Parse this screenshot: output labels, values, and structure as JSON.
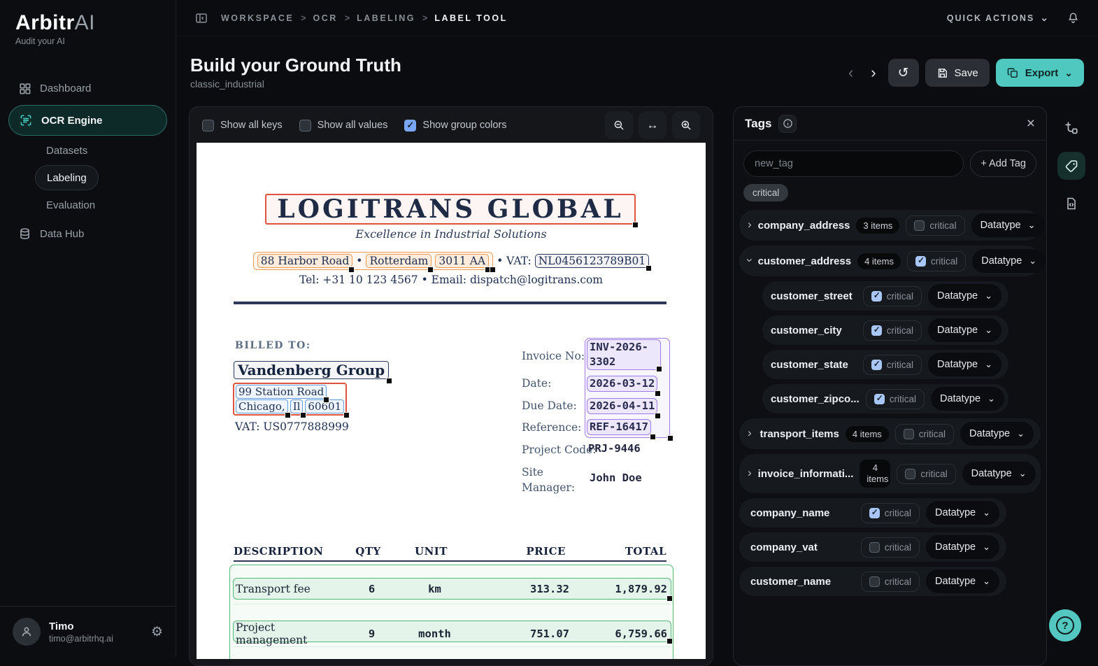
{
  "icons": {
    "chevron_left": "‹",
    "chevron_right": "›",
    "chevron_down": "⌄",
    "close": "×",
    "undo": "↺",
    "fit_width": "↔",
    "gear": "⚙",
    "question": "?"
  },
  "colors": {
    "accent": "#4fc8c0",
    "checkbox_blue": "#a9c6f8",
    "group_red": "#e0543f",
    "group_orange": "#f09a50",
    "group_blue": "#5f9ce0",
    "group_purple": "#9f7ce8",
    "group_green": "#53b979",
    "group_navy": "#2c3a5a"
  },
  "sidebar": {
    "brand": "Arbitr",
    "brand_suffix": "AI",
    "tagline": "Audit your AI",
    "dashboard": "Dashboard",
    "ocr_engine": "OCR Engine",
    "datasets": "Datasets",
    "labeling": "Labeling",
    "evaluation": "Evaluation",
    "data_hub": "Data Hub",
    "user": {
      "name": "Timo",
      "email": "timo@arbitrhq.ai"
    }
  },
  "topbar": {
    "breadcrumb": [
      "WORKSPACE",
      "OCR",
      "LABELING",
      "LABEL TOOL"
    ],
    "separator": ">",
    "quick_actions": "QUICK ACTIONS"
  },
  "header": {
    "title": "Build your Ground Truth",
    "subtitle": "classic_industrial",
    "save": "Save",
    "export": "Export"
  },
  "viewer": {
    "toggles": [
      {
        "label": "Show all keys",
        "checked": false
      },
      {
        "label": "Show all values",
        "checked": false
      },
      {
        "label": "Show group colors",
        "checked": true
      }
    ]
  },
  "document": {
    "company_name": "LOGITRANS GLOBAL",
    "tagline": "Excellence in Industrial Solutions",
    "address": {
      "street": "88 Harbor Road",
      "sep": "•",
      "city": "Rotterdam",
      "zip": "3011 AA",
      "vat_label": "• VAT:",
      "vat": "NL0456123789B01"
    },
    "contact": "Tel: +31 10 123 4567 • Email: dispatch@logitrans.com",
    "billed_to": "BILLED TO:",
    "customer": {
      "name": "Vandenberg Group",
      "street": "99 Station Road",
      "city": "Chicago,",
      "state": "Il",
      "zip": "60601",
      "vat": "VAT: US0777888999"
    },
    "invoice_info": [
      {
        "label": "Invoice No:",
        "value": "INV-2026-3302"
      },
      {
        "label": "Date:",
        "value": "2026-03-12"
      },
      {
        "label": "Due Date:",
        "value": "2026-04-11"
      },
      {
        "label": "Reference:",
        "value": "REF-16417"
      },
      {
        "label": "Project Code:",
        "value": "PRJ-9446"
      },
      {
        "label": "Site Manager:",
        "value": "John Doe"
      }
    ],
    "table": {
      "headers": [
        "DESCRIPTION",
        "QTY",
        "UNIT",
        "PRICE",
        "TOTAL"
      ],
      "rows": [
        [
          "Transport fee",
          "6",
          "km",
          "313.32",
          "1,879.92"
        ],
        [
          "Project management",
          "9",
          "month",
          "751.07",
          "6,759.66"
        ]
      ]
    }
  },
  "tags_panel": {
    "title": "Tags",
    "input_placeholder": "new_tag",
    "add_tag": "+ Add Tag",
    "chip": "critical",
    "critical_label": "critical",
    "datatype_label": "Datatype",
    "groups": [
      {
        "name": "company_address",
        "items": "3 items",
        "critical": false,
        "expanded": false
      },
      {
        "name": "customer_address",
        "items": "4 items",
        "critical": true,
        "expanded": true
      },
      {
        "name": "transport_items",
        "items": "4 items",
        "critical": false,
        "expanded": false
      },
      {
        "name": "invoice_informati...",
        "items": "4 items",
        "critical": false,
        "expanded": false
      }
    ],
    "children": [
      {
        "name": "customer_street",
        "critical": true
      },
      {
        "name": "customer_city",
        "critical": true
      },
      {
        "name": "customer_state",
        "critical": true
      },
      {
        "name": "customer_zipco...",
        "critical": true
      }
    ],
    "fields": [
      {
        "name": "company_name",
        "critical": true
      },
      {
        "name": "company_vat",
        "critical": false
      },
      {
        "name": "customer_name",
        "critical": false
      }
    ]
  }
}
